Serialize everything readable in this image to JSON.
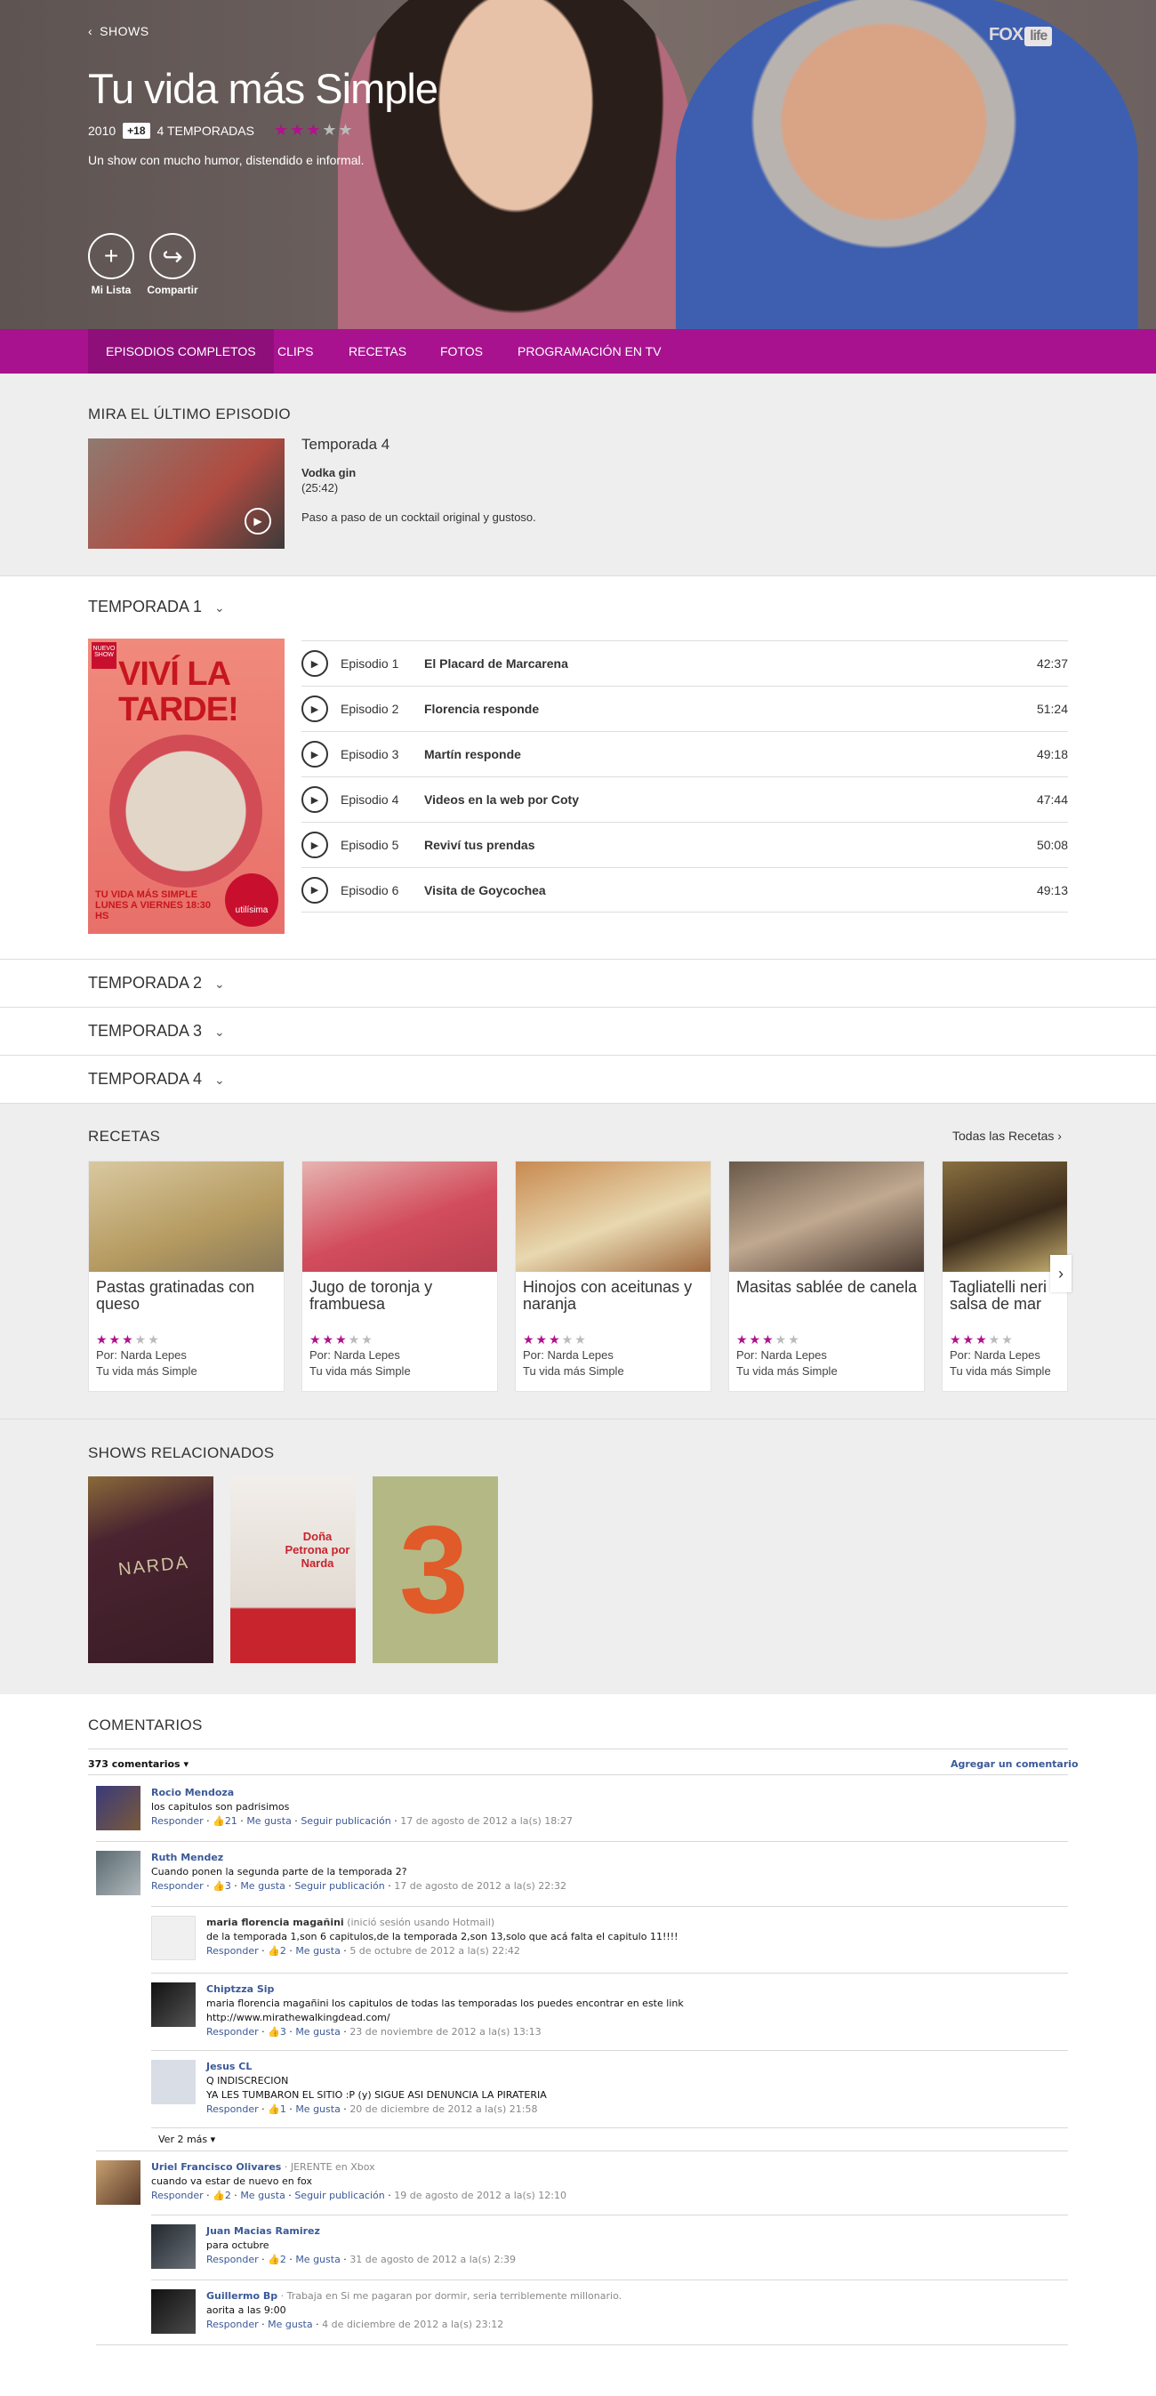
{
  "nav": {
    "back": "SHOWS",
    "logo_main": "FOX",
    "logo_tag": "life"
  },
  "show": {
    "title": "Tu vida más Simple",
    "year": "2010",
    "rating": "+18",
    "seasons": "4 TEMPORADAS",
    "stars": 3,
    "stars_max": 5,
    "description": "Un show con mucho humor, distendido e informal."
  },
  "actions": {
    "my_list": "Mi Lista",
    "share": "Compartir"
  },
  "tabs": [
    "EPISODIOS COMPLETOS",
    "CLIPS",
    "RECETAS",
    "FOTOS",
    "PROGRAMACIÓN EN TV"
  ],
  "latest": {
    "heading": "MIRA EL ÚLTIMO EPISODIO",
    "season": "Temporada 4",
    "title": "Vodka gin",
    "duration": "(25:42)",
    "description": "Paso a paso de un cocktail original y gustoso."
  },
  "season1": {
    "label": "TEMPORADA 1",
    "poster": {
      "badge": "NUEVO SHOW",
      "headline": "VIVÍ LA TARDE!",
      "sub": "TU VIDA MÁS SIMPLE LUNES A VIERNES 18:30 HS",
      "channel": "utilísima"
    },
    "episodes": [
      {
        "num": "Episodio 1",
        "title": "El Placard de Marcarena",
        "duration": "42:37"
      },
      {
        "num": "Episodio 2",
        "title": "Florencia responde",
        "duration": "51:24"
      },
      {
        "num": "Episodio 3",
        "title": "Martín responde",
        "duration": "49:18"
      },
      {
        "num": "Episodio 4",
        "title": "Videos en la web por Coty",
        "duration": "47:44"
      },
      {
        "num": "Episodio 5",
        "title": "Reviví tus prendas",
        "duration": "50:08"
      },
      {
        "num": "Episodio 6",
        "title": "Visita de Goycochea",
        "duration": "49:13"
      }
    ]
  },
  "other_seasons": [
    "TEMPORADA 2",
    "TEMPORADA 3",
    "TEMPORADA 4"
  ],
  "recipes": {
    "heading": "RECETAS",
    "all_link": "Todas las Recetas",
    "items": [
      {
        "title": "Pastas gratinadas con queso",
        "stars": 3,
        "author": "Por: Narda Lepes",
        "show": "Tu vida más Simple",
        "color": "#c9b27a"
      },
      {
        "title": "Jugo de toronja y frambuesa",
        "stars": 3,
        "author": "Por: Narda Lepes",
        "show": "Tu vida más Simple",
        "color": "#c95a6a"
      },
      {
        "title": "Hinojos con aceitunas y naranja",
        "stars": 3,
        "author": "Por: Narda Lepes",
        "show": "Tu vida más Simple",
        "color": "#b88450"
      },
      {
        "title": "Masitas sablée de canela",
        "stars": 3,
        "author": "Por: Narda Lepes",
        "show": "Tu vida más Simple",
        "color": "#7c6a5a"
      },
      {
        "title": "Tagliatelli neri salsa de mar",
        "stars": 3,
        "author": "Por: Narda Lepes",
        "show": "Tu vida más Simple",
        "color": "#5e4a2a"
      }
    ]
  },
  "related": {
    "heading": "SHOWS RELACIONADOS",
    "items": [
      {
        "label": "NARDA",
        "color": "#4a2430"
      },
      {
        "label": "Doña Petrona por Narda",
        "color": "#e8e2da"
      },
      {
        "label": "3",
        "color": "#b4b884"
      }
    ]
  },
  "comments": {
    "heading": "COMENTARIOS",
    "count": "373 comentarios",
    "add": "Agregar un comentario",
    "more": "Ver 2 más",
    "reply": "Responder",
    "like": "Me gusta",
    "follow": "Seguir publicación",
    "items": [
      {
        "name": "Rocio Mendoza",
        "note": "",
        "text1": "los capitulos son padrisimos",
        "text2": "",
        "likes": "21",
        "follow": true,
        "date": "17 de agosto de 2012 a la(s) 18:27",
        "color": "#7a5a3a"
      },
      {
        "name": "Ruth Mendez",
        "note": "",
        "text1": "Cuando ponen la segunda parte de la temporada 2?",
        "text2": "",
        "likes": "3",
        "follow": true,
        "date": "17 de agosto de 2012 a la(s) 22:32",
        "color": "#8a8f90"
      },
      {
        "name": "maria florencia magañini",
        "note": "(inició sesión usando Hotmail)",
        "text1": "de la temporada 1,son 6 capitulos,de la temporada 2,son 13,solo que acá falta el capitulo 11!!!!",
        "text2": "",
        "likes": "2",
        "follow": false,
        "date": "5 de octubre de 2012 a la(s) 22:42",
        "color": "#f0f0f0"
      },
      {
        "name": "Chiptzza Sip",
        "note": "",
        "text1": "maria florencia magañini los capitulos de todas las temporadas los puedes encontrar en este link",
        "text2": "http://www.mirathewalkingdead.com/",
        "likes": "3",
        "follow": false,
        "date": "23 de noviembre de 2012 a la(s) 13:13",
        "color": "#2a2a2a"
      },
      {
        "name": "Jesus CL",
        "note": "",
        "text1": "Q INDISCRECION",
        "text2": "YA LES TUMBARON EL SITIO :P (y) SIGUE ASI DENUNCIA LA PIRATERIA",
        "likes": "1",
        "follow": false,
        "date": "20 de diciembre de 2012 a la(s) 21:58",
        "color": "#d8dde6"
      },
      {
        "name": "Uriel Francisco Olivares",
        "note": "· JERENTE en Xbox",
        "text1": "cuando va estar de nuevo en fox",
        "text2": "",
        "likes": "2",
        "follow": true,
        "date": "19 de agosto de 2012 a la(s) 12:10",
        "color": "#8a6a4a"
      },
      {
        "name": "Juan Macias Ramirez",
        "note": "",
        "text1": "para octubre",
        "text2": "",
        "likes": "2",
        "follow": false,
        "date": "31 de agosto de 2012 a la(s) 2:39",
        "color": "#3a4048"
      },
      {
        "name": "Guillermo Bp",
        "note": "· Trabaja en Si me pagaran por dormir, seria terriblemente millonario.",
        "text1": "aorita a las 9:00",
        "text2": "",
        "likes": "",
        "follow": false,
        "date": "4 de diciembre de 2012 a la(s) 23:12",
        "color": "#2c2c2c"
      }
    ]
  },
  "colors": {
    "accent": "#a8128f",
    "link": "#3b5998"
  }
}
